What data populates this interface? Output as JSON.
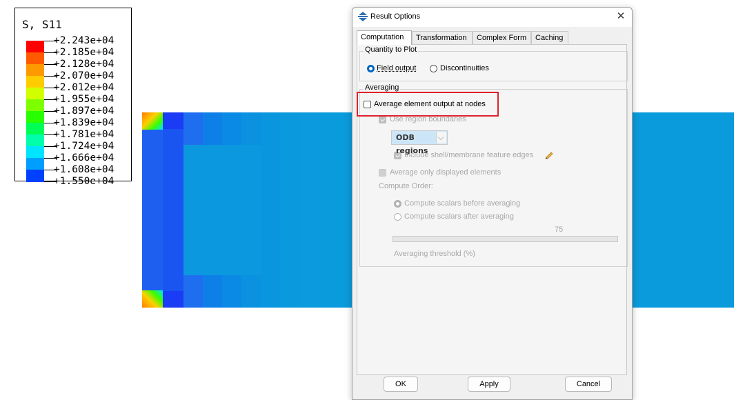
{
  "legend": {
    "title": "S, S11",
    "labels": [
      "+2.243e+04",
      "+2.185e+04",
      "+2.128e+04",
      "+2.070e+04",
      "+2.012e+04",
      "+1.955e+04",
      "+1.897e+04",
      "+1.839e+04",
      "+1.781e+04",
      "+1.724e+04",
      "+1.666e+04",
      "+1.608e+04",
      "+1.550e+04"
    ],
    "band_colors": [
      "#ff0000",
      "#ff5a00",
      "#ff9900",
      "#ffcc00",
      "#d2ff00",
      "#7dff00",
      "#28ff00",
      "#00ff55",
      "#00ffaa",
      "#00e5ff",
      "#009fff",
      "#0040ff"
    ]
  },
  "dialog": {
    "title": "Result Options",
    "tabs": [
      "Computation",
      "Transformation",
      "Complex Form",
      "Caching"
    ],
    "active_tab": "Computation",
    "quantity_group": {
      "title": "Quantity to Plot",
      "options": [
        "Field output",
        "Discontinuities"
      ],
      "selected": "Field output"
    },
    "averaging_group": {
      "title": "Averaging",
      "average_at_nodes": "Average element output at nodes",
      "use_region_boundaries": "Use region boundaries",
      "region_select": "ODB regions",
      "include_edges": "Include shell/membrane feature edges",
      "average_displayed": "Average only displayed elements",
      "compute_order_label": "Compute Order:",
      "compute_options": [
        "Compute scalars before averaging",
        "Compute scalars after averaging"
      ],
      "threshold_value": "75",
      "threshold_label": "Averaging threshold (%)"
    },
    "buttons": {
      "ok": "OK",
      "apply": "Apply",
      "cancel": "Cancel"
    }
  },
  "colors": {
    "accent": "#0067c0",
    "highlight": "#e0202c"
  }
}
